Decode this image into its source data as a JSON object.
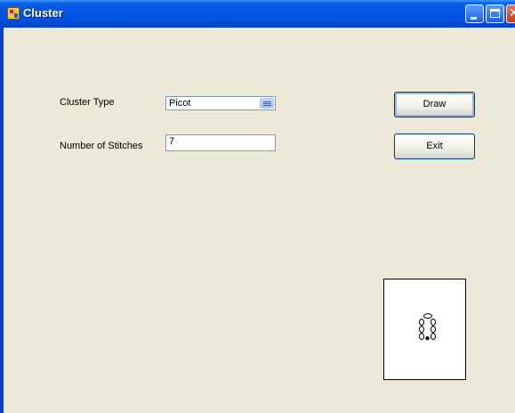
{
  "window": {
    "title": "Cluster",
    "controls": [
      "minimize-icon",
      "maximize-icon",
      "close-icon"
    ]
  },
  "form": {
    "cluster_type_label": "Cluster Type",
    "cluster_type_value": "Picot",
    "stitches_label": "Number of Stitches",
    "stitches_value": "7"
  },
  "buttons": {
    "draw_label": "Draw",
    "exit_label": "Exit"
  },
  "preview": {
    "stitch_count": 7,
    "stitch_type": "picot"
  }
}
